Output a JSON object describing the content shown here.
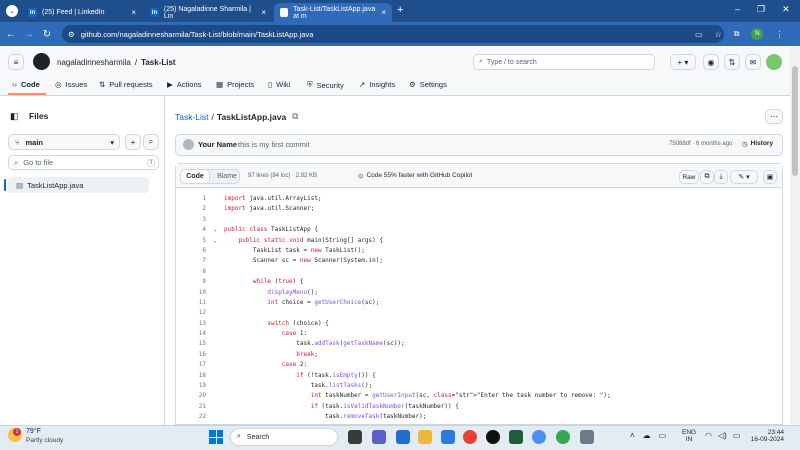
{
  "tabs": [
    {
      "label": "(25) Feed | LinkedIn"
    },
    {
      "label": "(25) Nagaladinne Sharmila | Lin"
    },
    {
      "label": "Task-List/TaskListApp.java at m"
    }
  ],
  "url": "github.com/nagaladinnesharmila/Task-List/blob/main/TaskListApp.java",
  "header": {
    "owner": "nagaladinnesharmila",
    "sep": "/",
    "repo": "Task-List",
    "search_placeholder": "Type / to search"
  },
  "repo_nav": [
    {
      "label": "Code"
    },
    {
      "label": "Issues"
    },
    {
      "label": "Pull requests"
    },
    {
      "label": "Actions"
    },
    {
      "label": "Projects"
    },
    {
      "label": "Wiki"
    },
    {
      "label": "Security"
    },
    {
      "label": "Insights"
    },
    {
      "label": "Settings"
    }
  ],
  "sidebar": {
    "title": "Files",
    "branch": "main",
    "goto_placeholder": "Go to file",
    "goto_key": "t",
    "file": "TaskListApp.java"
  },
  "breadcrumb": {
    "repo": "Task-List",
    "sep": "/",
    "file": "TaskListApp.java"
  },
  "commit": {
    "author": "Your Name",
    "message": "this is my first commit",
    "hash_time": "75088df · 6 months ago",
    "history": "History"
  },
  "toolbar": {
    "code": "Code",
    "blame": "Blame",
    "stats": "97 lines (84 loc) · 2.82 KB",
    "copilot": "Code 55% faster with GitHub Copilot",
    "raw": "Raw"
  },
  "code_lines": [
    {
      "n": "1",
      "t": "import java.util.ArrayList;"
    },
    {
      "n": "2",
      "t": "import java.util.Scanner;"
    },
    {
      "n": "3",
      "t": ""
    },
    {
      "n": "4",
      "t": "public class TaskListApp {"
    },
    {
      "n": "5",
      "t": "    public static void main(String[] args) {"
    },
    {
      "n": "6",
      "t": "        TaskList task = new TaskList();"
    },
    {
      "n": "7",
      "t": "        Scanner sc = new Scanner(System.in);"
    },
    {
      "n": "8",
      "t": ""
    },
    {
      "n": "9",
      "t": "        while (true) {"
    },
    {
      "n": "10",
      "t": "            displayMenu();"
    },
    {
      "n": "11",
      "t": "            int choice = getUserChoice(sc);"
    },
    {
      "n": "12",
      "t": ""
    },
    {
      "n": "13",
      "t": "            switch (choice) {"
    },
    {
      "n": "14",
      "t": "                case 1:"
    },
    {
      "n": "15",
      "t": "                    task.addTask(getTaskName(sc));"
    },
    {
      "n": "16",
      "t": "                    break;"
    },
    {
      "n": "17",
      "t": "                case 2:"
    },
    {
      "n": "18",
      "t": "                    if (!task.isEmpty()) {"
    },
    {
      "n": "19",
      "t": "                        task.listTasks();"
    },
    {
      "n": "20",
      "t": "                        int taskNumber = getUserInput(sc, \"Enter the task number to remove: \");"
    },
    {
      "n": "21",
      "t": "                        if (task.isValidTaskNumber(taskNumber)) {"
    },
    {
      "n": "22",
      "t": "                            task.removeTask(taskNumber);"
    }
  ],
  "taskbar": {
    "temp": "79°F",
    "weather": "Partly cloudy",
    "search": "Search",
    "lang1": "ENG",
    "lang2": "IN",
    "time": "23:44",
    "date": "16-09-2024",
    "badge": "1"
  }
}
